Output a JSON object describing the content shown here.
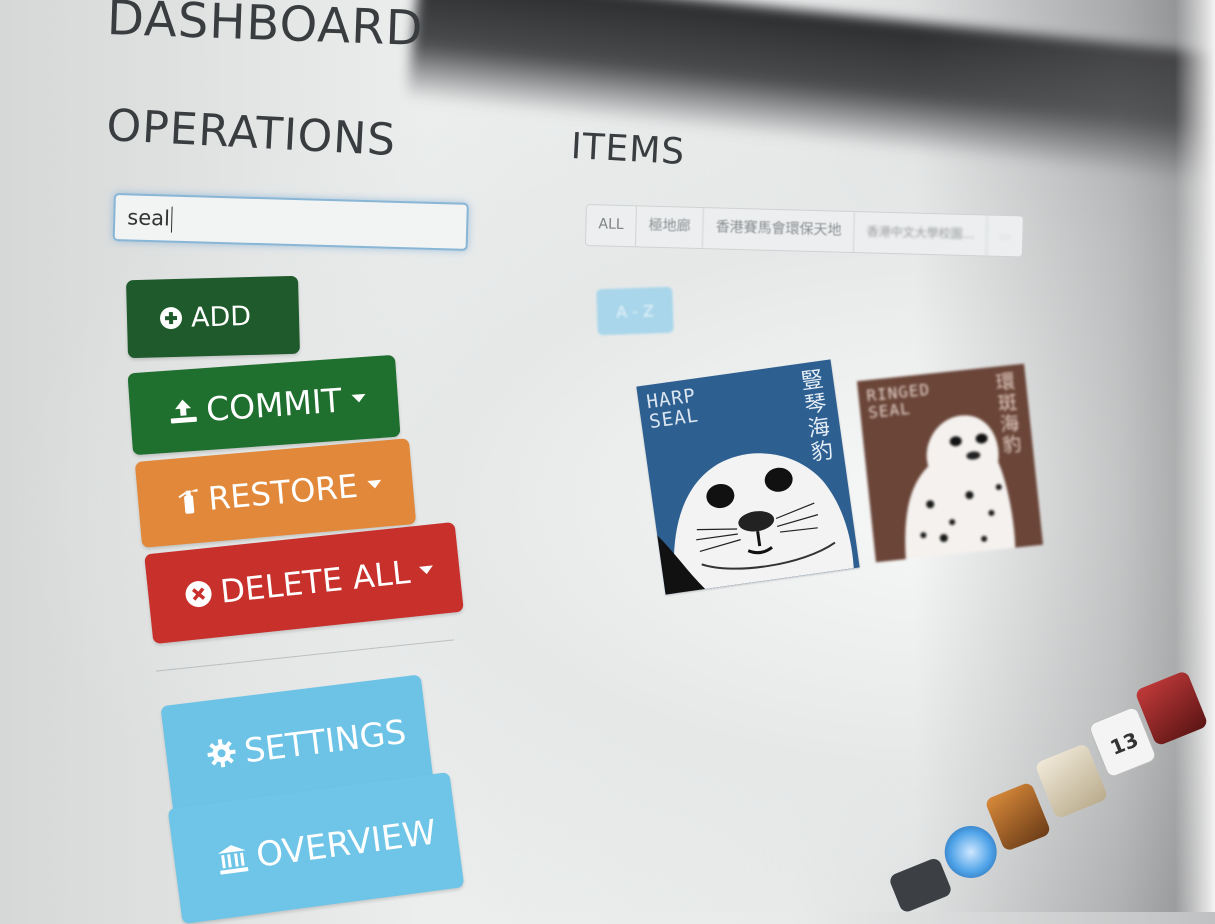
{
  "page": {
    "title": "DASHBOARD"
  },
  "operations": {
    "title": "OPERATIONS",
    "search_value": "seal",
    "buttons": {
      "add": "ADD",
      "commit": "COMMIT",
      "restore": "RESTORE",
      "delete_all": "DELETE ALL",
      "settings": "SETTINGS",
      "overview": "OVERVIEW"
    },
    "colors": {
      "add": "#1e5a2b",
      "commit": "#1f6f2e",
      "restore": "#e2883a",
      "delete_all": "#c8302c",
      "settings": "#6cc3e6",
      "overview": "#6fc5e7"
    }
  },
  "items": {
    "title": "ITEMS",
    "tabs": [
      "ALL",
      "極地廊",
      "香港賽馬會環保天地",
      "香港中文大學校園…",
      "…"
    ],
    "sort_button": "A - Z",
    "cards": [
      {
        "english": [
          "HARP",
          "SEAL"
        ],
        "chinese": "豎琴海豹",
        "bg_color": "#2d5f91"
      },
      {
        "english": [
          "RINGED",
          "SEAL"
        ],
        "chinese": "環斑海豹",
        "bg_color": "#6a4538"
      }
    ]
  },
  "dock": {
    "calendar_day": "13",
    "icons": [
      "app-icon",
      "dvd-player-icon",
      "garageband-icon",
      "preview-icon",
      "calendar-icon",
      "photo-booth-icon"
    ]
  }
}
